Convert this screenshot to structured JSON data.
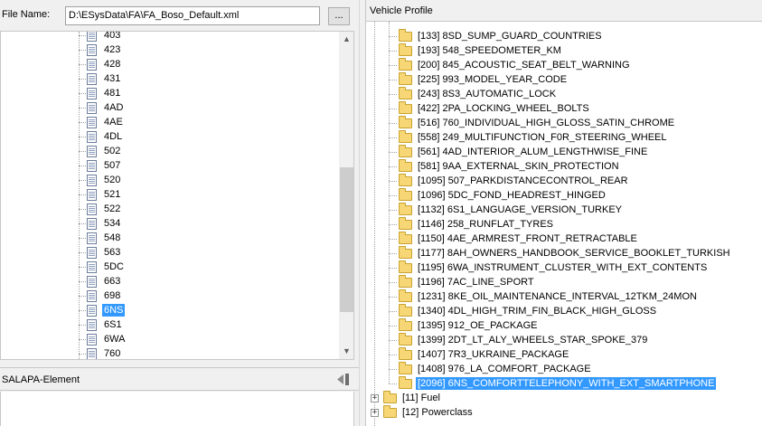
{
  "file": {
    "label": "File Name:",
    "value": "D:\\ESysData\\FA\\FA_Boso_Default.xml",
    "browse_label": "..."
  },
  "file_list": {
    "items": [
      "403",
      "423",
      "428",
      "431",
      "481",
      "4AD",
      "4AE",
      "4DL",
      "502",
      "507",
      "520",
      "521",
      "522",
      "534",
      "548",
      "563",
      "5DC",
      "663",
      "698",
      "6NS",
      "6S1",
      "6WA",
      "760"
    ],
    "selected": "6NS"
  },
  "salapa": {
    "title": "SALAPA-Element"
  },
  "vehicle_profile": {
    "title": "Vehicle Profile",
    "options": [
      "[133] 8SD_SUMP_GUARD_COUNTRIES",
      "[193] 548_SPEEDOMETER_KM",
      "[200] 845_ACOUSTIC_SEAT_BELT_WARNING",
      "[225] 993_MODEL_YEAR_CODE",
      "[243] 8S3_AUTOMATIC_LOCK",
      "[422] 2PA_LOCKING_WHEEL_BOLTS",
      "[516] 760_INDIVIDUAL_HIGH_GLOSS_SATIN_CHROME",
      "[558] 249_MULTIFUNCTION_F0R_STEERING_WHEEL",
      "[561] 4AD_INTERIOR_ALUM_LENGTHWISE_FINE",
      "[581] 9AA_EXTERNAL_SKIN_PROTECTION",
      "[1095] 507_PARKDISTANCECONTROL_REAR",
      "[1096] 5DC_FOND_HEADREST_HINGED",
      "[1132] 6S1_LANGUAGE_VERSION_TURKEY",
      "[1146] 258_RUNFLAT_TYRES",
      "[1150] 4AE_ARMREST_FRONT_RETRACTABLE",
      "[1177] 8AH_OWNERS_HANDBOOK_SERVICE_BOOKLET_TURKISH",
      "[1195] 6WA_INSTRUMENT_CLUSTER_WITH_EXT_CONTENTS",
      "[1196] 7AC_LINE_SPORT",
      "[1231] 8KE_OIL_MAINTENANCE_INTERVAL_12TKM_24MON",
      "[1340] 4DL_HIGH_TRIM_FIN_BLACK_HIGH_GLOSS",
      "[1395] 912_OE_PACKAGE",
      "[1399] 2DT_LT_ALY_WHEELS_STAR_SPOKE_379",
      "[1407] 7R3_UKRAINE_PACKAGE",
      "[1408] 976_LA_COMFORT_PACKAGE",
      "[2096] 6NS_COMFORTTELEPHONY_WITH_EXT_SMARTPHONE"
    ],
    "selected": "[2096] 6NS_COMFORTTELEPHONY_WITH_EXT_SMARTPHONE",
    "groups": [
      "[11] Fuel",
      "[12] Powerclass"
    ]
  }
}
